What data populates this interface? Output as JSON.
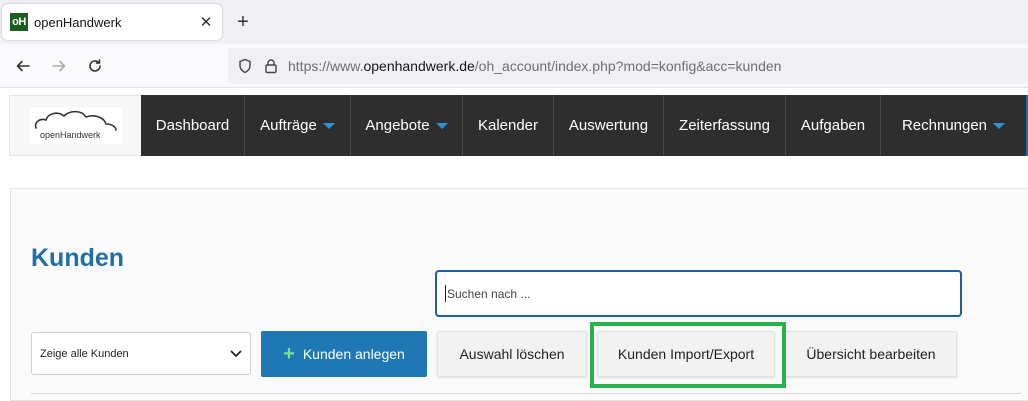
{
  "browser": {
    "tab_title": "openHandwerk",
    "favicon_text": "oH",
    "url_prefix": "https://www.",
    "url_host": "openhandwerk.de",
    "url_path": "/oh_account/index.php?mod=konfig&acc=kunden"
  },
  "app": {
    "logo_text": "openHandwerk",
    "menu": [
      {
        "label": "Dashboard",
        "dropdown": false
      },
      {
        "label": "Aufträge",
        "dropdown": true
      },
      {
        "label": "Angebote",
        "dropdown": true
      },
      {
        "label": "Kalender",
        "dropdown": false
      },
      {
        "label": "Auswertung",
        "dropdown": false
      },
      {
        "label": "Zeiterfassung",
        "dropdown": false
      },
      {
        "label": "Aufgaben",
        "dropdown": false
      },
      {
        "label": "Rechnungen",
        "dropdown": true
      }
    ]
  },
  "page": {
    "title": "Kunden",
    "search_placeholder": "Suchen nach ...",
    "filter_selected": "Zeige alle Kunden",
    "buttons": {
      "create": "Kunden anlegen",
      "clear": "Auswahl löschen",
      "import_export": "Kunden Import/Export",
      "edit_overview": "Übersicht bearbeiten"
    }
  },
  "colors": {
    "accent": "#1f77b4",
    "highlight": "#27b34a",
    "menu_bg": "#2e2e2e"
  }
}
